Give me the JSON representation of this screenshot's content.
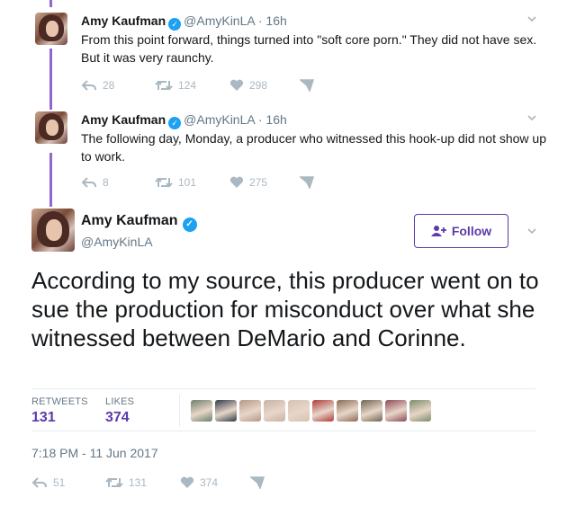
{
  "tweets": [
    {
      "name": "Amy Kaufman",
      "handle": "@AmyKinLA",
      "time": "16h",
      "text": "From this point forward, things turned into \"soft core porn.\" They did not have sex. But it was very raunchy.",
      "replies": "28",
      "retweets": "124",
      "likes": "298"
    },
    {
      "name": "Amy Kaufman",
      "handle": "@AmyKinLA",
      "time": "16h",
      "text": "The following day, Monday, a producer who witnessed this hook-up did not show up to work.",
      "replies": "8",
      "retweets": "101",
      "likes": "275"
    }
  ],
  "main": {
    "name": "Amy Kaufman",
    "handle": "@AmyKinLA",
    "follow_label": "Follow",
    "text": "According to my source, this producer went on to sue the production for misconduct over what she witnessed between DeMario and Corinne.",
    "retweets_label": "RETWEETS",
    "retweets_count": "131",
    "likes_label": "LIKES",
    "likes_count": "374",
    "date": "7:18 PM - 11 Jun 2017",
    "replies": "51",
    "retweets": "131",
    "likes": "374"
  },
  "dot": "·",
  "icons": [
    "verified-icon",
    "chevron-down-icon",
    "reply-icon",
    "retweet-icon",
    "heart-icon",
    "direct-message-icon",
    "follow-person-icon"
  ],
  "colors": {
    "accent": "#5d3aa8",
    "thread_line": "#9266cc",
    "verified": "#1da1f2",
    "muted": "#657786",
    "action_gray": "#aab8c2"
  },
  "liker_colors": [
    "#6b7f6a",
    "#2f3a45",
    "#b69887",
    "#c7b3a5",
    "#d5c2b3",
    "#b03a3a",
    "#8a6b55",
    "#6e6452",
    "#8c4a58",
    "#7d8b6a"
  ]
}
